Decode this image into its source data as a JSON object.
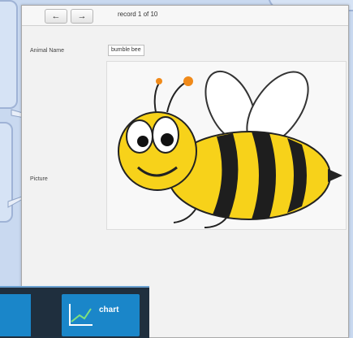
{
  "window": {
    "back_glyph": "←",
    "forward_glyph": "→",
    "record_text": "record 1 of 10"
  },
  "fields": {
    "name_label": "Animal Name",
    "name_value": "bumble bee",
    "picture_label": "Picture"
  },
  "taskbar": {
    "chart_label": "chart",
    "chart_icon": "line-chart-icon"
  },
  "colors": {
    "desktop": "#c9d9f0",
    "taskbar": "#1f2f3e",
    "tile": "#1a86c9",
    "bee_yellow": "#f7d21a"
  }
}
